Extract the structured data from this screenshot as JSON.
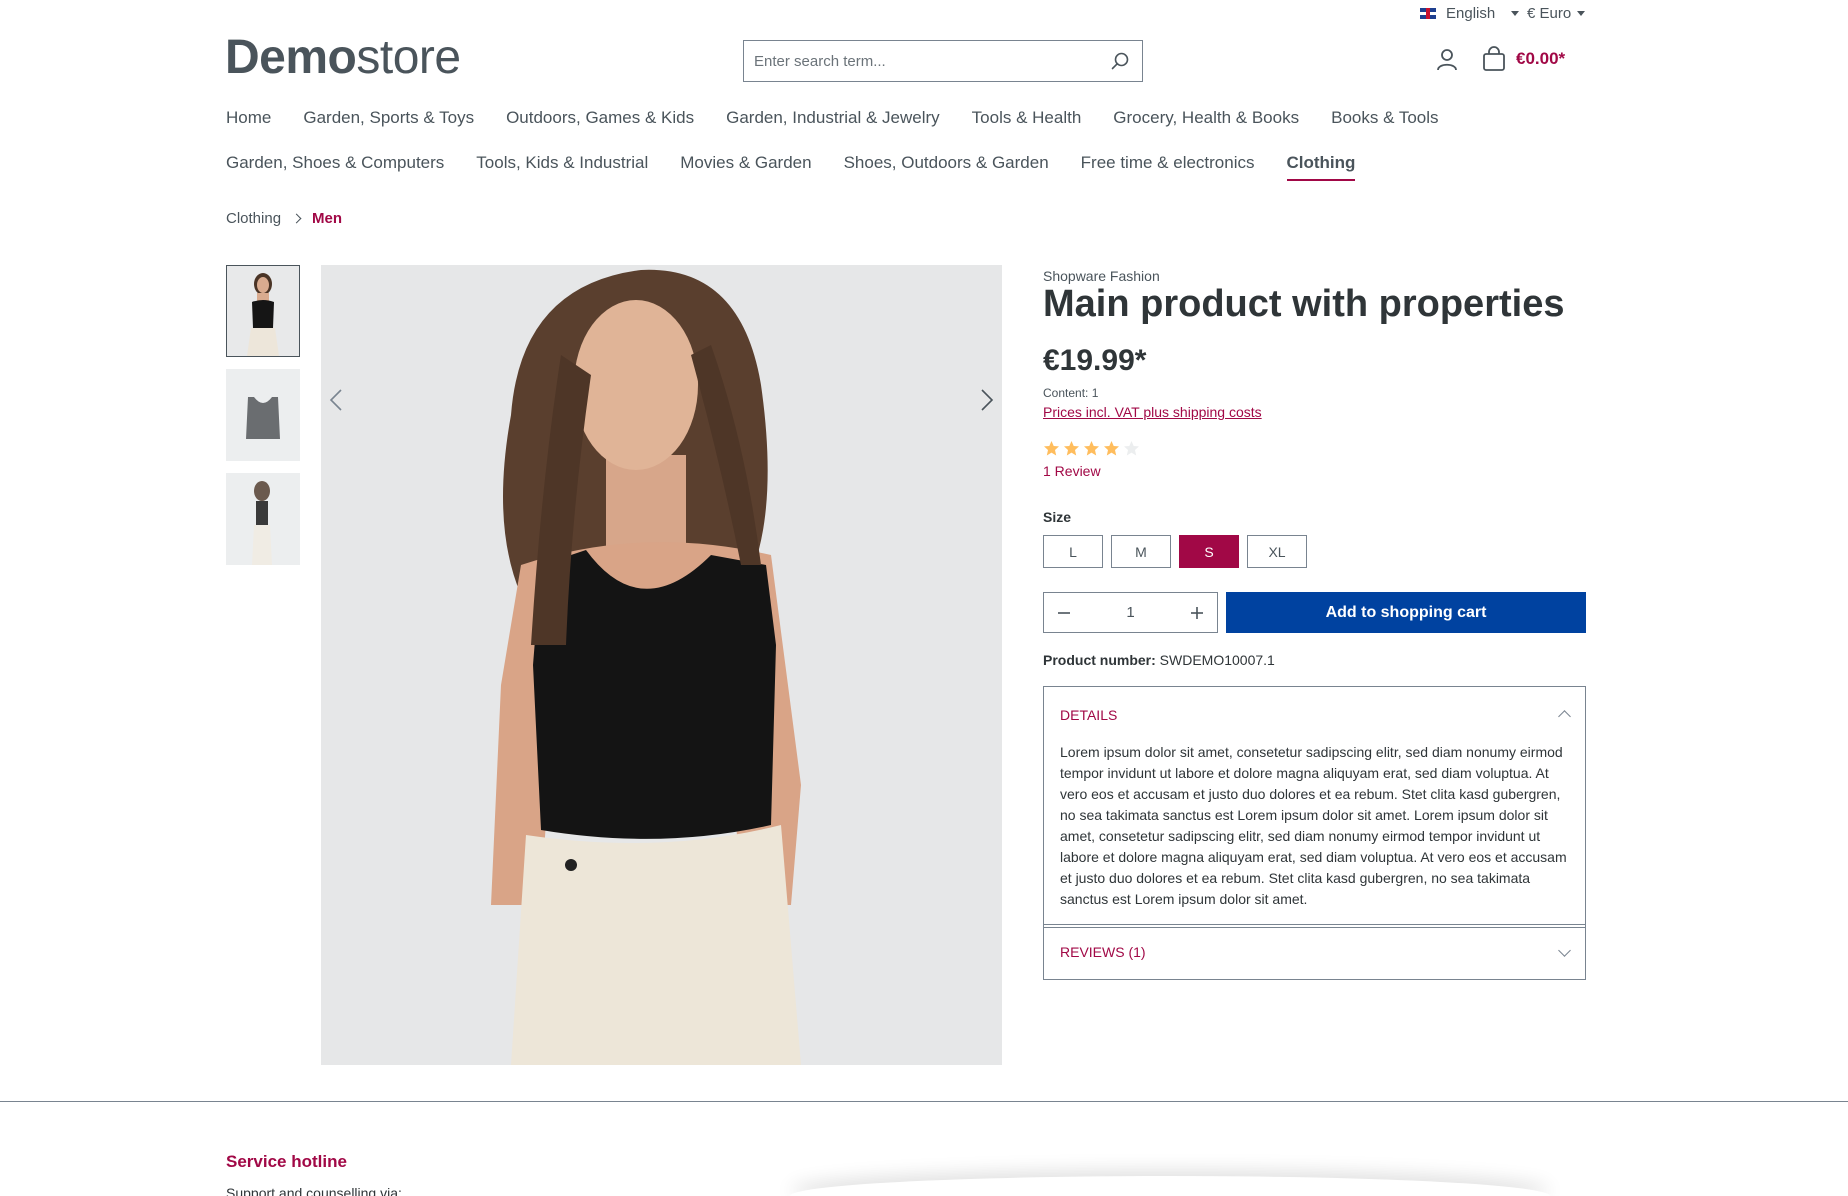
{
  "topbar": {
    "language": "English",
    "currency": "€ Euro"
  },
  "header": {
    "logo_bold": "Demo",
    "logo_light": "store",
    "search_placeholder": "Enter search term...",
    "cart_total": "€0.00*"
  },
  "nav": {
    "row1": [
      "Home",
      "Garden, Sports & Toys",
      "Outdoors, Games & Kids",
      "Garden, Industrial & Jewelry",
      "Tools & Health",
      "Grocery, Health & Books",
      "Books & Tools"
    ],
    "row2": [
      "Garden, Shoes & Computers",
      "Tools, Kids & Industrial",
      "Movies & Garden",
      "Shoes, Outdoors & Garden",
      "Free time & electronics",
      "Clothing"
    ],
    "active": "Clothing"
  },
  "breadcrumb": [
    "Clothing",
    "Men"
  ],
  "product": {
    "manufacturer": "Shopware Fashion",
    "title": "Main product with properties",
    "price": "€19.99*",
    "content": "Content: 1",
    "vat_link": "Prices incl. VAT plus shipping costs",
    "rating": 4,
    "rating_max": 5,
    "review_link": "1 Review",
    "size_label": "Size",
    "sizes": [
      "L",
      "M",
      "S",
      "XL"
    ],
    "selected_size": "S",
    "quantity": "1",
    "add_to_cart": "Add to shopping cart",
    "product_number_label": "Product number:",
    "product_number": "SWDEMO10007.1"
  },
  "details": {
    "title": "DETAILS",
    "text": "Lorem ipsum dolor sit amet, consetetur sadipscing elitr, sed diam nonumy eirmod tempor invidunt ut labore et dolore magna aliquyam erat, sed diam voluptua. At vero eos et accusam et justo duo dolores et ea rebum. Stet clita kasd gubergren, no sea takimata sanctus est Lorem ipsum dolor sit amet. Lorem ipsum dolor sit amet, consetetur sadipscing elitr, sed diam nonumy eirmod tempor invidunt ut labore et dolore magna aliquyam erat, sed diam voluptua. At vero eos et accusam et justo duo dolores et ea rebum. Stet clita kasd gubergren, no sea takimata sanctus est Lorem ipsum dolor sit amet."
  },
  "reviews": {
    "title": "REVIEWS (1)"
  },
  "footer": {
    "hotline": "Service hotline",
    "support": "Support and counselling via:"
  },
  "colors": {
    "accent": "#a10846",
    "primary_button": "#0042a0",
    "star": "#ffbd5d",
    "text": "#4a545b"
  }
}
